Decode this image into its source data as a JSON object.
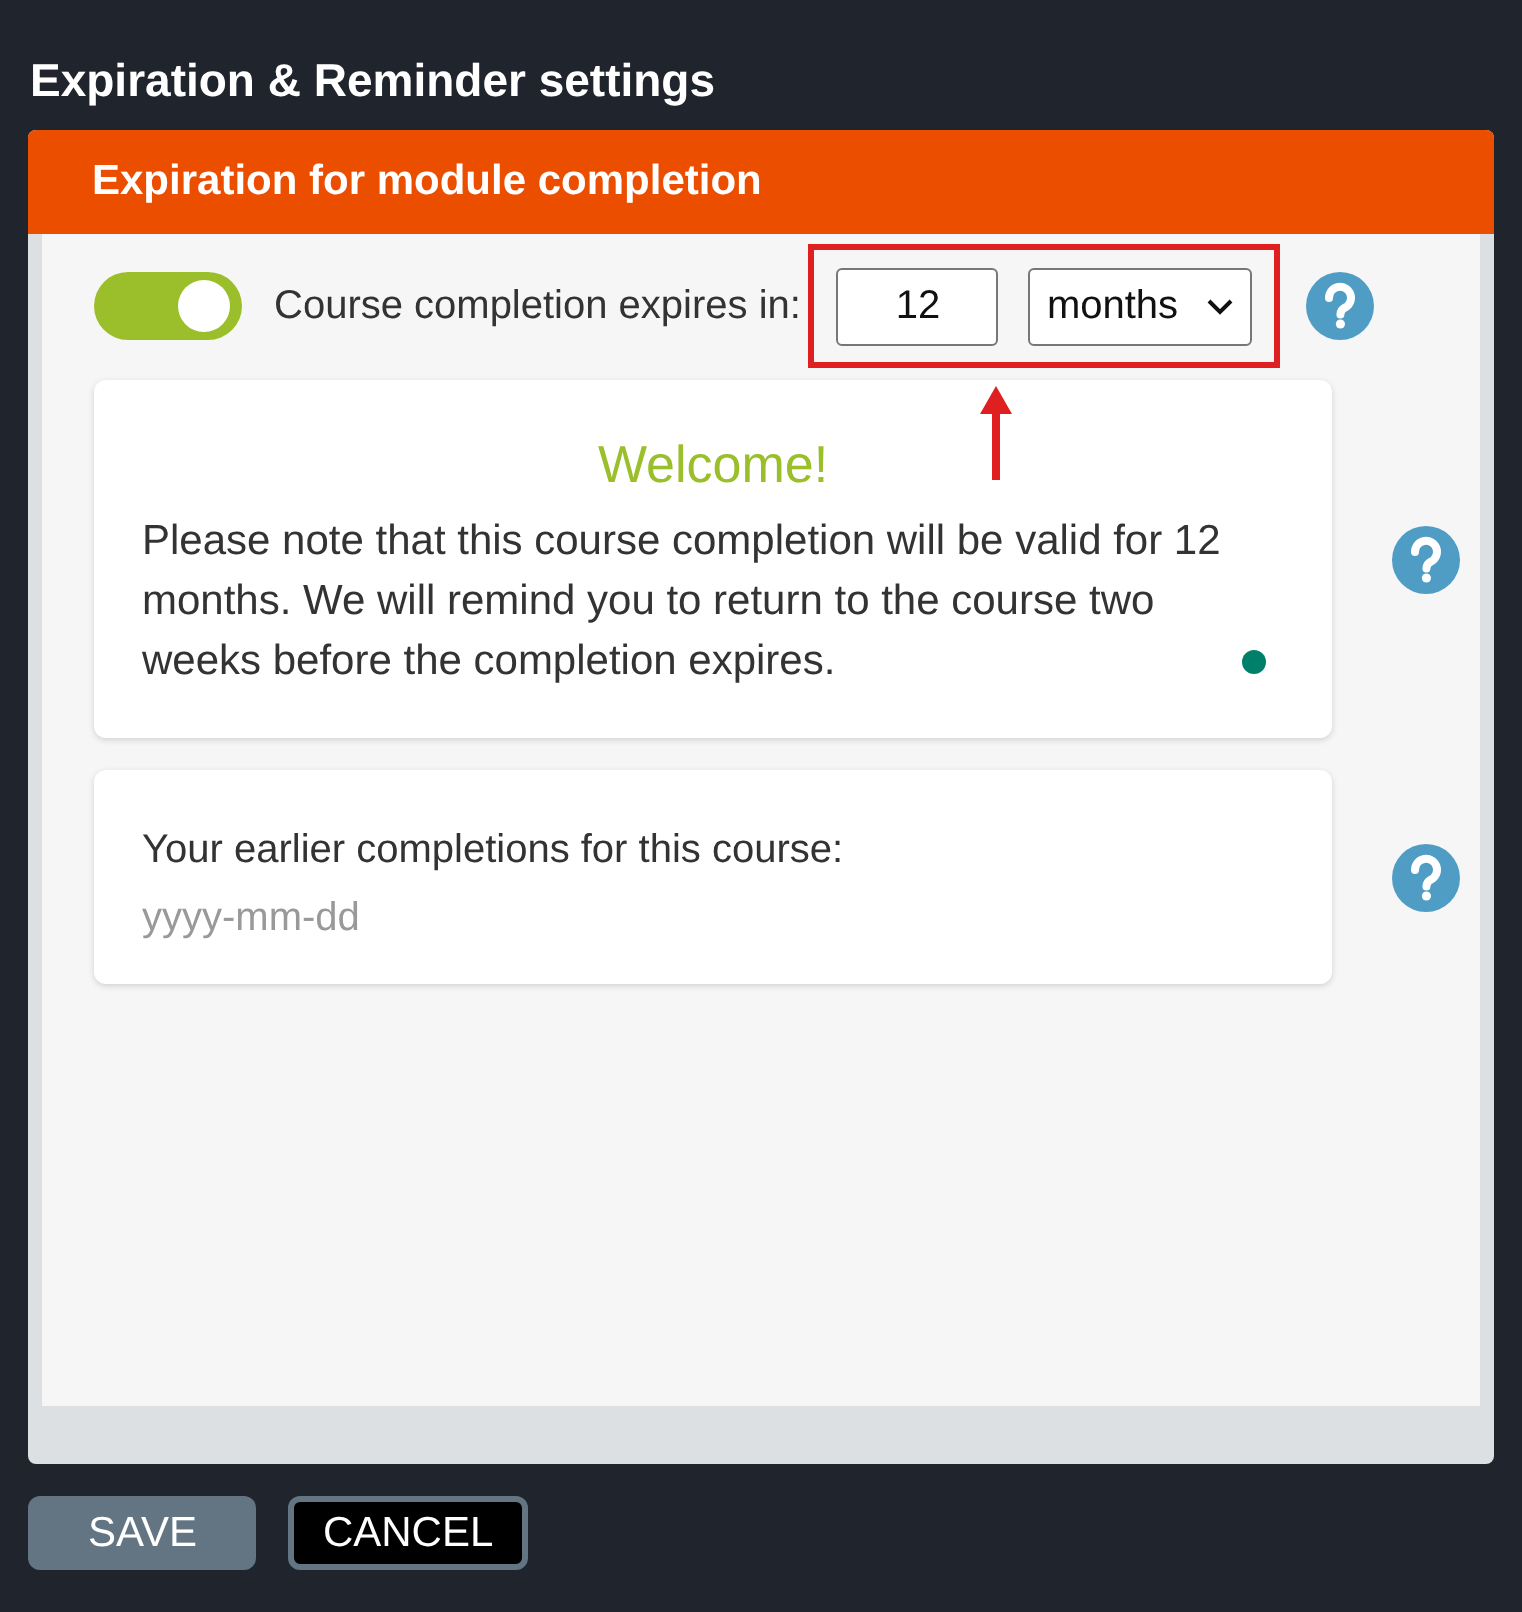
{
  "window": {
    "title": "Expiration & Reminder settings"
  },
  "section": {
    "title": "Expiration for module completion"
  },
  "expiry": {
    "toggle_on": true,
    "label": "Course completion expires in:",
    "value": "12",
    "unit": "months",
    "highlighted": true
  },
  "welcome_card": {
    "heading": "Welcome!",
    "text": "Please note that this course completion will be valid for 12 months. We will remind you to return to the course two weeks before the completion expires."
  },
  "history_card": {
    "label": "Your earlier completions for this course:",
    "placeholder": "yyyy-mm-dd"
  },
  "buttons": [
    {
      "label": "SAVE",
      "kind": "primary"
    },
    {
      "label": "CANCEL",
      "kind": "secondary"
    }
  ]
}
